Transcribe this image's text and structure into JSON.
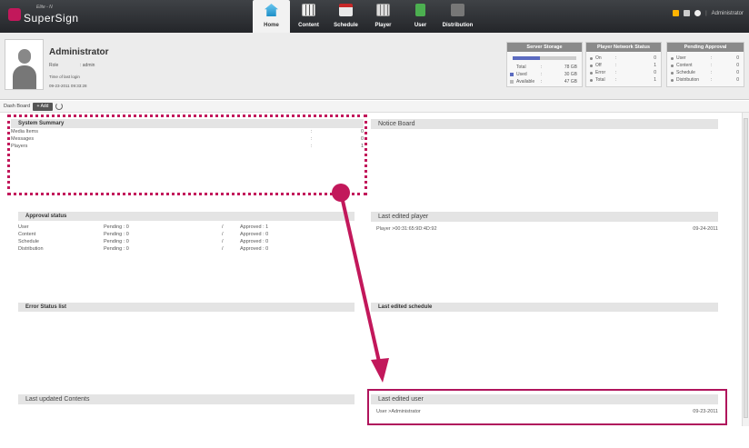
{
  "app": {
    "logo_sub": "Elite - N",
    "logo_text": "SuperSign",
    "nav": [
      {
        "label": "Home",
        "active": true
      },
      {
        "label": "Content"
      },
      {
        "label": "Schedule"
      },
      {
        "label": "Player"
      },
      {
        "label": "User"
      },
      {
        "label": "Distribution"
      }
    ],
    "topright_user": "Administrator",
    "topright_sep": "|"
  },
  "profile": {
    "name": "Administrator",
    "role_label": "Role",
    "role_value": ": admin",
    "last_login_label": "Time of last login",
    "last_login_value": "09-23-2011 09:33:28"
  },
  "server_storage": {
    "title": "Server Storage",
    "used_fraction": 0.43,
    "rows": [
      {
        "label": "Total",
        "sep": ":",
        "value": "78 GB"
      },
      {
        "label": "Used",
        "sep": ":",
        "value": "30 GB"
      },
      {
        "label": "Available",
        "sep": ":",
        "value": "47 GB"
      }
    ]
  },
  "player_network": {
    "title": "Player Network Status",
    "rows": [
      {
        "label": "On",
        "sep": ":",
        "value": "0"
      },
      {
        "label": "Off",
        "sep": ":",
        "value": "1"
      },
      {
        "label": "Error",
        "sep": ":",
        "value": "0"
      },
      {
        "label": "Total",
        "sep": ":",
        "value": "1"
      }
    ]
  },
  "pending_approval": {
    "title": "Pending Approval",
    "rows": [
      {
        "label": "User",
        "sep": ":",
        "value": "0"
      },
      {
        "label": "Content",
        "sep": ":",
        "value": "0"
      },
      {
        "label": "Schedule",
        "sep": ":",
        "value": "0"
      },
      {
        "label": "Distribution",
        "sep": ":",
        "value": "0"
      }
    ]
  },
  "dashboard": {
    "label": "Dash Board",
    "add_label": "+ Add"
  },
  "system_summary": {
    "title": "System Summary",
    "rows": [
      {
        "label": "Media Items",
        "sep": ":",
        "value": "0"
      },
      {
        "label": "Messages",
        "sep": ":",
        "value": "0"
      },
      {
        "label": "Players",
        "sep": ":",
        "value": "1"
      }
    ]
  },
  "notice_board": {
    "title": "Notice Board"
  },
  "approval_status": {
    "title": "Approval status",
    "rows": [
      {
        "label": "User",
        "pending": "Pending : 0",
        "slash": "/",
        "approved": "Approved : 1"
      },
      {
        "label": "Content",
        "pending": "Pending : 0",
        "slash": "/",
        "approved": "Approved : 0"
      },
      {
        "label": "Schedule",
        "pending": "Pending : 0",
        "slash": "/",
        "approved": "Approved : 0"
      },
      {
        "label": "Distribution",
        "pending": "Pending : 0",
        "slash": "/",
        "approved": "Approved : 0"
      }
    ]
  },
  "last_edited_player": {
    "title": "Last edited player",
    "item": "Player >00:31:65:9D:4D:92",
    "date": "09-24-2011"
  },
  "error_status": {
    "title": "Error Status list"
  },
  "last_edited_schedule": {
    "title": "Last edited schedule"
  },
  "last_updated_contents": {
    "title": "Last updated Contents"
  },
  "last_edited_user": {
    "title": "Last edited user",
    "item": "User >Administrator",
    "date": "09-23-2011"
  },
  "colors": {
    "accent": "#c2185b",
    "bar_used": "#5b6bc0"
  }
}
